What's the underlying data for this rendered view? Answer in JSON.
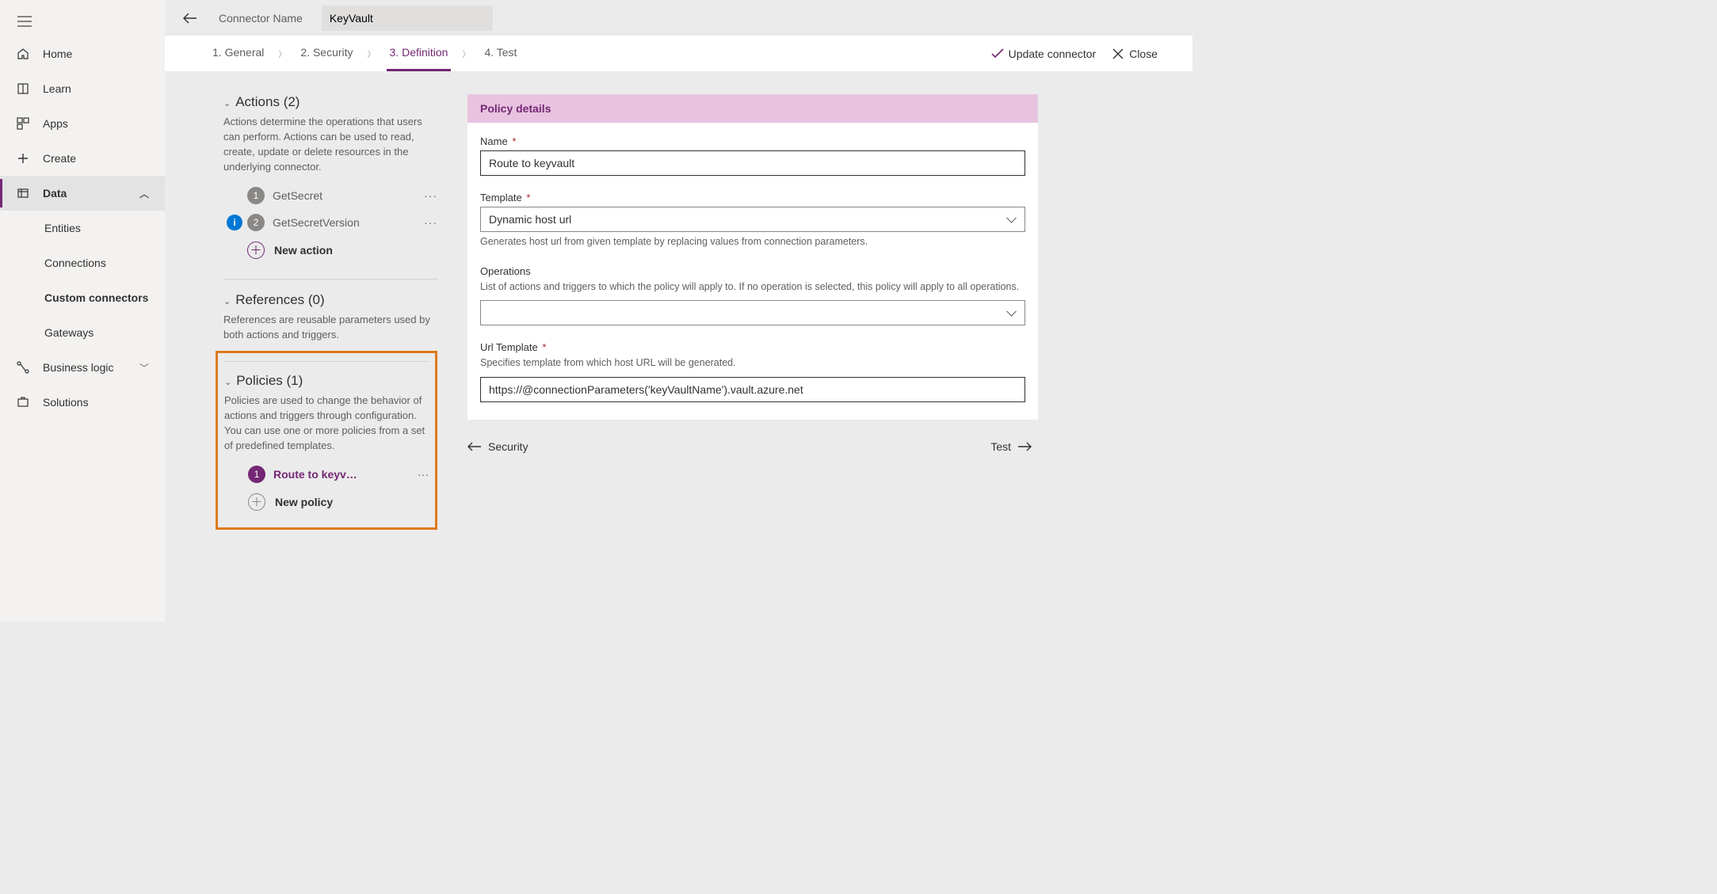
{
  "sidebar": {
    "home": "Home",
    "learn": "Learn",
    "apps": "Apps",
    "create": "Create",
    "data": "Data",
    "entities": "Entities",
    "connections": "Connections",
    "custom_connectors": "Custom connectors",
    "gateways": "Gateways",
    "business_logic": "Business logic",
    "solutions": "Solutions"
  },
  "header": {
    "label": "Connector Name",
    "value": "KeyVault"
  },
  "steps": {
    "s1": "1. General",
    "s2": "2. Security",
    "s3": "3. Definition",
    "s4": "4. Test"
  },
  "commands": {
    "update": "Update connector",
    "close": "Close"
  },
  "actions_section": {
    "title": "Actions (2)",
    "desc": "Actions determine the operations that users can perform. Actions can be used to read, create, update or delete resources in the underlying connector.",
    "item1": "GetSecret",
    "item2": "GetSecretVersion",
    "new": "New action"
  },
  "refs_section": {
    "title": "References (0)",
    "desc": "References are reusable parameters used by both actions and triggers."
  },
  "policies_section": {
    "title": "Policies (1)",
    "desc": "Policies are used to change the behavior of actions and triggers through configuration. You can use one or more policies from a set of predefined templates.",
    "item1": "Route to keyv…",
    "new": "New policy"
  },
  "form": {
    "header": "Policy details",
    "name_label": "Name",
    "name_value": "Route to keyvault",
    "template_label": "Template",
    "template_value": "Dynamic host url",
    "template_help": "Generates host url from given template by replacing values from connection parameters.",
    "ops_label": "Operations",
    "ops_help": "List of actions and triggers to which the policy will apply to. If no operation is selected, this policy will apply to all operations.",
    "url_label": "Url Template",
    "url_help": "Specifies template from which host URL will be generated.",
    "url_value": "https://@connectionParameters('keyVaultName').vault.azure.net"
  },
  "bottom": {
    "prev": "Security",
    "next": "Test"
  }
}
